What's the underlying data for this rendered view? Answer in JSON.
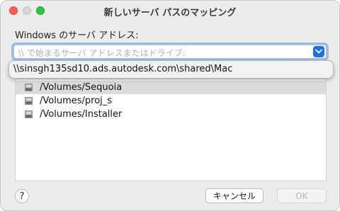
{
  "window": {
    "title": "新しいサーバ パスのマッピング"
  },
  "form": {
    "field_label": "Windows のサーバ アドレス:",
    "input_placeholder": "\\\\ で始まるサーバ アドレスまたはドライブ:"
  },
  "dropdown": {
    "items": [
      "\\\\sinsgh135sd10.ads.autodesk.com\\shared\\Mac"
    ]
  },
  "list": {
    "rows": [
      {
        "label": "/Volumes/Sequoia",
        "selected": true,
        "icon": "disk-icon"
      },
      {
        "label": "/Volumes/proj_s",
        "selected": false,
        "icon": "disk-icon"
      },
      {
        "label": "/Volumes/Installer",
        "selected": false,
        "icon": "disk-icon"
      }
    ]
  },
  "buttons": {
    "help": "?",
    "cancel": "キャンセル",
    "ok": "OK"
  },
  "colors": {
    "accent": "#1f6fe5",
    "close": "#ff5f57",
    "zoom": "#28c840"
  }
}
